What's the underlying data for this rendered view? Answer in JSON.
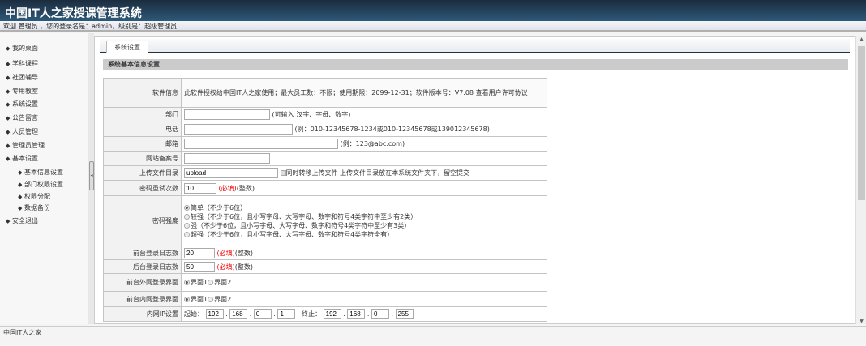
{
  "header": {
    "title": "中国IT人之家授课管理系统",
    "welcome": "欢迎 管理员 ，您的登录名是：admin，级别是：超级管理员"
  },
  "sidebar": {
    "items": [
      "我的桌面",
      "学科课程",
      "社团辅导",
      "专用教室",
      "系统设置",
      "公告留言",
      "人员管理",
      "管理员管理",
      "基本设置"
    ],
    "subitems": [
      "基本信息设置",
      "部门权限设置",
      "权限分配",
      "数据备份"
    ],
    "logout": "安全退出"
  },
  "tab": "系统设置",
  "section": "系统基本信息设置",
  "form": {
    "software_label": "软件信息",
    "software_text": "此软件授权给中国IT人之家使用；最大员工数：不限；使用期限：2099-12-31；软件版本号：V7.08",
    "license_link": "查看用户许可协议",
    "dept_label": "部门",
    "dept_hint": "(可输入 汉字、字母、数字)",
    "dept_value": "",
    "phone_label": "电话",
    "phone_hint": "(例：010-12345678-1234或010-12345678或139012345678)",
    "phone_value": "",
    "email_label": "邮箱",
    "email_hint": "(例：123@abc.com)",
    "email_value": "",
    "icp_label": "网站备案号",
    "icp_value": "",
    "upload_label": "上传文件目录",
    "upload_value": "upload",
    "upload_check": "同时转移上传文件",
    "upload_hint": "上传文件目录放在本系统文件夹下，留空提交",
    "retry_label": "密码重试次数",
    "retry_value": "10",
    "required": "(必填)",
    "integer": "(整数)",
    "strength_label": "密码强度",
    "strength_options": [
      "简单（不少于6位）",
      "较强（不少于6位，且小写字母、大写字母、数字和符号4类字符中至少有2类）",
      "强（不少于6位，且小写字母、大写字母、数字和符号4类字符中至少有3类）",
      "超强（不少于6位，且小写字母、大写字母、数字和符号4类字符全有）"
    ],
    "front_log_label": "前台登录日志数",
    "front_log_value": "20",
    "back_log_label": "后台登录日志数",
    "back_log_value": "50",
    "outer_ui_label": "前台外网登录界面",
    "inner_ui_label": "前台内网登录界面",
    "ui_options": [
      "界面1",
      "界面2"
    ],
    "ip_label": "内网IP设置",
    "ip_start": "起始：",
    "ip_end": "终止：",
    "ip_start_parts": [
      "192",
      "168",
      "0",
      "1"
    ],
    "ip_end_parts": [
      "192",
      "168",
      "0",
      "255"
    ],
    "dot": "."
  },
  "footer": "中国IT人之家"
}
